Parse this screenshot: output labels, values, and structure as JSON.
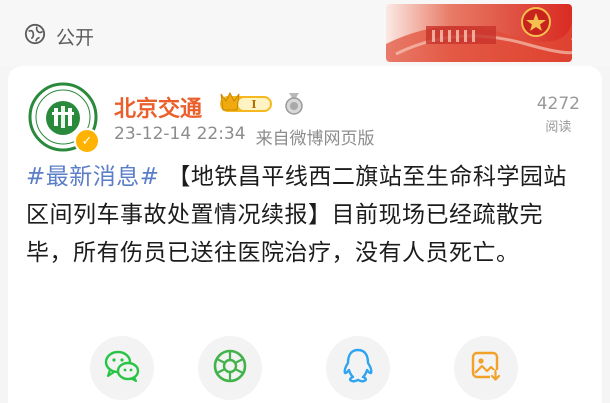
{
  "visibility": {
    "label": "公开",
    "icon": "globe-icon"
  },
  "post": {
    "author": "北京交通",
    "badge_level": "I",
    "time": "23-12-14 22:34",
    "source": "来自微博网页版",
    "reads": {
      "count": "4272",
      "label": "阅读"
    },
    "hashtag": "#最新消息#",
    "body": "【地铁昌平线西二旗站至生命科学园站区间列车事故处置情况续报】目前现场已经疏散完毕，所有伤员已送往医院治疗，没有人员死亡。"
  },
  "share": [
    {
      "name": "wechat",
      "icon": "wechat-icon",
      "color": "#28c445"
    },
    {
      "name": "moments",
      "icon": "moments-icon",
      "color": "#42b24b"
    },
    {
      "name": "qq",
      "icon": "qq-icon",
      "color": "#2fa4f0"
    },
    {
      "name": "save-image",
      "icon": "save-image-icon",
      "color": "#f2a129"
    }
  ]
}
